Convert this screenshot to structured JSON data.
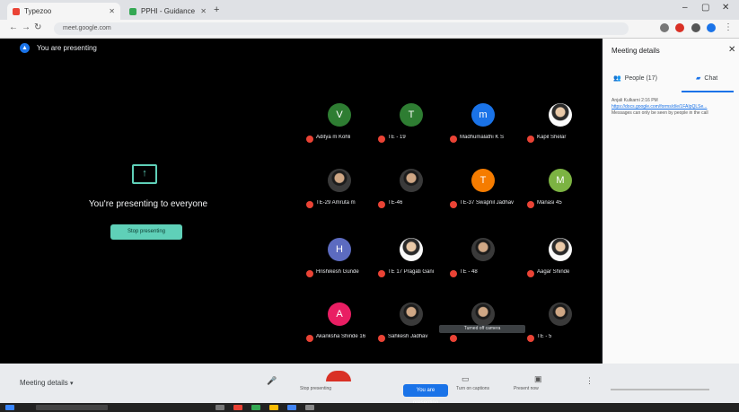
{
  "browser": {
    "tabs": [
      {
        "label": "Typezoo",
        "color": "#ea4335"
      },
      {
        "label": "PPHI - Guidance",
        "color": "#34a853"
      }
    ],
    "address": "meet.google.com"
  },
  "stage": {
    "presenting_banner": "You are presenting",
    "present_message": "You're presenting to everyone",
    "stop_button": "Stop presenting",
    "tooltip": "Turned off camera"
  },
  "participants": [
    {
      "name": "Aditya m Kohli",
      "initial": "V",
      "color": "#2e7d32",
      "avatar": "initial"
    },
    {
      "name": "TE - 19",
      "initial": "T",
      "color": "#2e7d32",
      "avatar": "initial"
    },
    {
      "name": "Madhumalathi K S",
      "initial": "m",
      "color": "#1a73e8",
      "avatar": "initial"
    },
    {
      "name": "Kapil Shelar",
      "initial": "",
      "color": "#ffffff",
      "avatar": "photo"
    },
    {
      "name": "TE-29 Amruta m",
      "initial": "",
      "color": "#ffffff",
      "avatar": "photo2"
    },
    {
      "name": "TE-46",
      "initial": "",
      "color": "#ffffff",
      "avatar": "photo2"
    },
    {
      "name": "TE-37 Swapnil Jadhav",
      "initial": "T",
      "color": "#f57c00",
      "avatar": "initial"
    },
    {
      "name": "Manasi 45",
      "initial": "M",
      "color": "#7cb342",
      "avatar": "initial"
    },
    {
      "name": "Hrishikesh Gunde",
      "initial": "H",
      "color": "#5c6bc0",
      "avatar": "initial"
    },
    {
      "name": "TE 17 Pragati Gani",
      "initial": "",
      "color": "#ffffff",
      "avatar": "photo"
    },
    {
      "name": "TE - 48",
      "initial": "",
      "color": "#ffffff",
      "avatar": "photo2"
    },
    {
      "name": "Aagar Shinde",
      "initial": "",
      "color": "#ffffff",
      "avatar": "photo"
    },
    {
      "name": "Akanksha Shinde 16",
      "initial": "A",
      "color": "#e91e63",
      "avatar": "initial"
    },
    {
      "name": "Sahkesh Jadhav",
      "initial": "",
      "color": "#ffffff",
      "avatar": "photo2"
    },
    {
      "name": "",
      "initial": "",
      "color": "#ffffff",
      "avatar": "photo2"
    },
    {
      "name": "TE - 5",
      "initial": "",
      "color": "#ffffff",
      "avatar": "photo2"
    }
  ],
  "side_panel": {
    "title": "Meeting details",
    "people_tab": "People (17)",
    "chat_tab": "Chat",
    "chat_text_1": "Anjali Kulkarni 2:16 PM",
    "chat_link": "https://docs.google.com/forms/d/e/1FAIpQLSe...",
    "chat_text_2": "Messages can only be seen by people in the call"
  },
  "controls": {
    "meeting_label": "Meeting details",
    "stop_label": "Stop presenting",
    "present_label": "You are presenting",
    "captions_label": "Turn on captions",
    "present_now": "Present now"
  }
}
